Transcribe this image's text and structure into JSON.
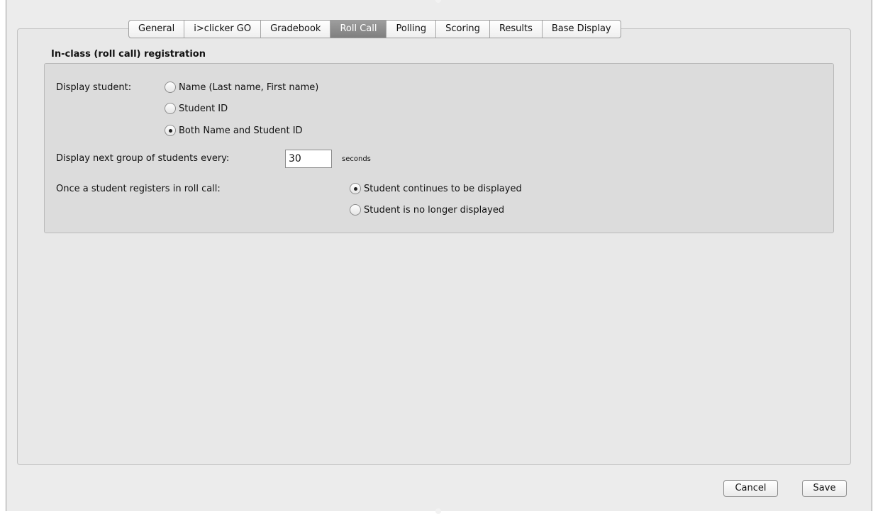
{
  "tabs": [
    {
      "label": "General"
    },
    {
      "label": "i>clicker GO"
    },
    {
      "label": "Gradebook"
    },
    {
      "label": "Roll Call"
    },
    {
      "label": "Polling"
    },
    {
      "label": "Scoring"
    },
    {
      "label": "Results"
    },
    {
      "label": "Base Display"
    }
  ],
  "active_tab": "Roll Call",
  "section": {
    "title": "In-class (roll call) registration"
  },
  "display_student": {
    "label": "Display student:",
    "options": [
      {
        "label": "Name (Last name, First name)",
        "selected": false
      },
      {
        "label": "Student ID",
        "selected": false
      },
      {
        "label": "Both Name and Student ID",
        "selected": true
      }
    ]
  },
  "next_group": {
    "label": "Display next group of students every:",
    "value": "30",
    "unit": "seconds"
  },
  "registers": {
    "label": "Once a student registers in roll call:",
    "options": [
      {
        "label": "Student continues to be displayed",
        "selected": true
      },
      {
        "label": "Student is no longer displayed",
        "selected": false
      }
    ]
  },
  "buttons": {
    "cancel": "Cancel",
    "save": "Save"
  }
}
